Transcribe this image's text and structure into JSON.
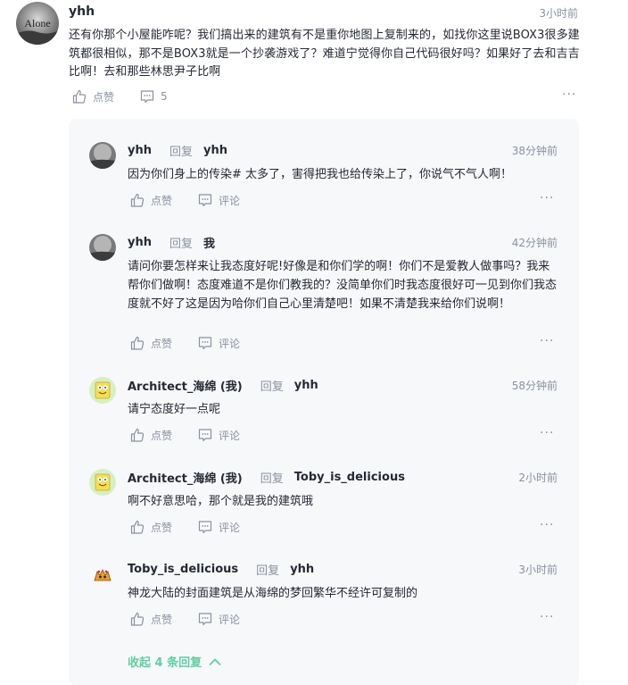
{
  "comment": {
    "username": "yhh",
    "time": "3小时前",
    "text": "还有你那个小屋能咋呢？我们搞出来的建筑有不是重你地图上复制来的，如找你这里说BOX3很多建筑都很相似，那不是BOX3就是一个抄袭游戏了？难道宁觉得你自己代码很好吗？如果好了去和吉吉比啊！去和那些林思尹子比啊",
    "like_label": "点赞",
    "comment_count": "5",
    "avatar_text": "Alone"
  },
  "replies": [
    {
      "user": "yhh",
      "reply_word": "回复",
      "target": "yhh",
      "time": "38分钟前",
      "text": "因为你们身上的传染# 太多了，害得把我也给传染上了，你说气不气人啊！",
      "like_label": "点赞",
      "comment_label": "评论"
    },
    {
      "user": "yhh",
      "reply_word": "回复",
      "target": "我",
      "time": "42分钟前",
      "text": "请问你要怎样来让我态度好呢!好像是和你们学的啊！你们不是爱教人做事吗？我来帮你们做啊！态度难道不是你们教我的？没简单你们时我态度很好可一见到你们我态度就不好了这是因为哈你们自己心里清楚吧！如果不清楚我来给你们说啊！",
      "like_label": "点赞",
      "comment_label": "评论"
    },
    {
      "user": "Architect_海绵 (我)",
      "reply_word": "回复",
      "target": "yhh",
      "time": "58分钟前",
      "text": "请宁态度好一点呢",
      "like_label": "点赞",
      "comment_label": "评论"
    },
    {
      "user": "Architect_海绵 (我)",
      "reply_word": "回复",
      "target": "Toby_is_delicious",
      "time": "2小时前",
      "text": "啊不好意思哈，那个就是我的建筑哦",
      "like_label": "点赞",
      "comment_label": "评论"
    },
    {
      "user": "Toby_is_delicious",
      "reply_word": "回复",
      "target": "yhh",
      "time": "3小时前",
      "text": "神龙大陆的封面建筑是从海绵的梦回繁华不经许可复制的",
      "like_label": "点赞",
      "comment_label": "评论"
    }
  ],
  "collapse_label": "收起 4 条回复",
  "colors": {
    "accent": "#5ecfa2",
    "muted": "#8a919f",
    "panel": "#f7f8fa"
  }
}
